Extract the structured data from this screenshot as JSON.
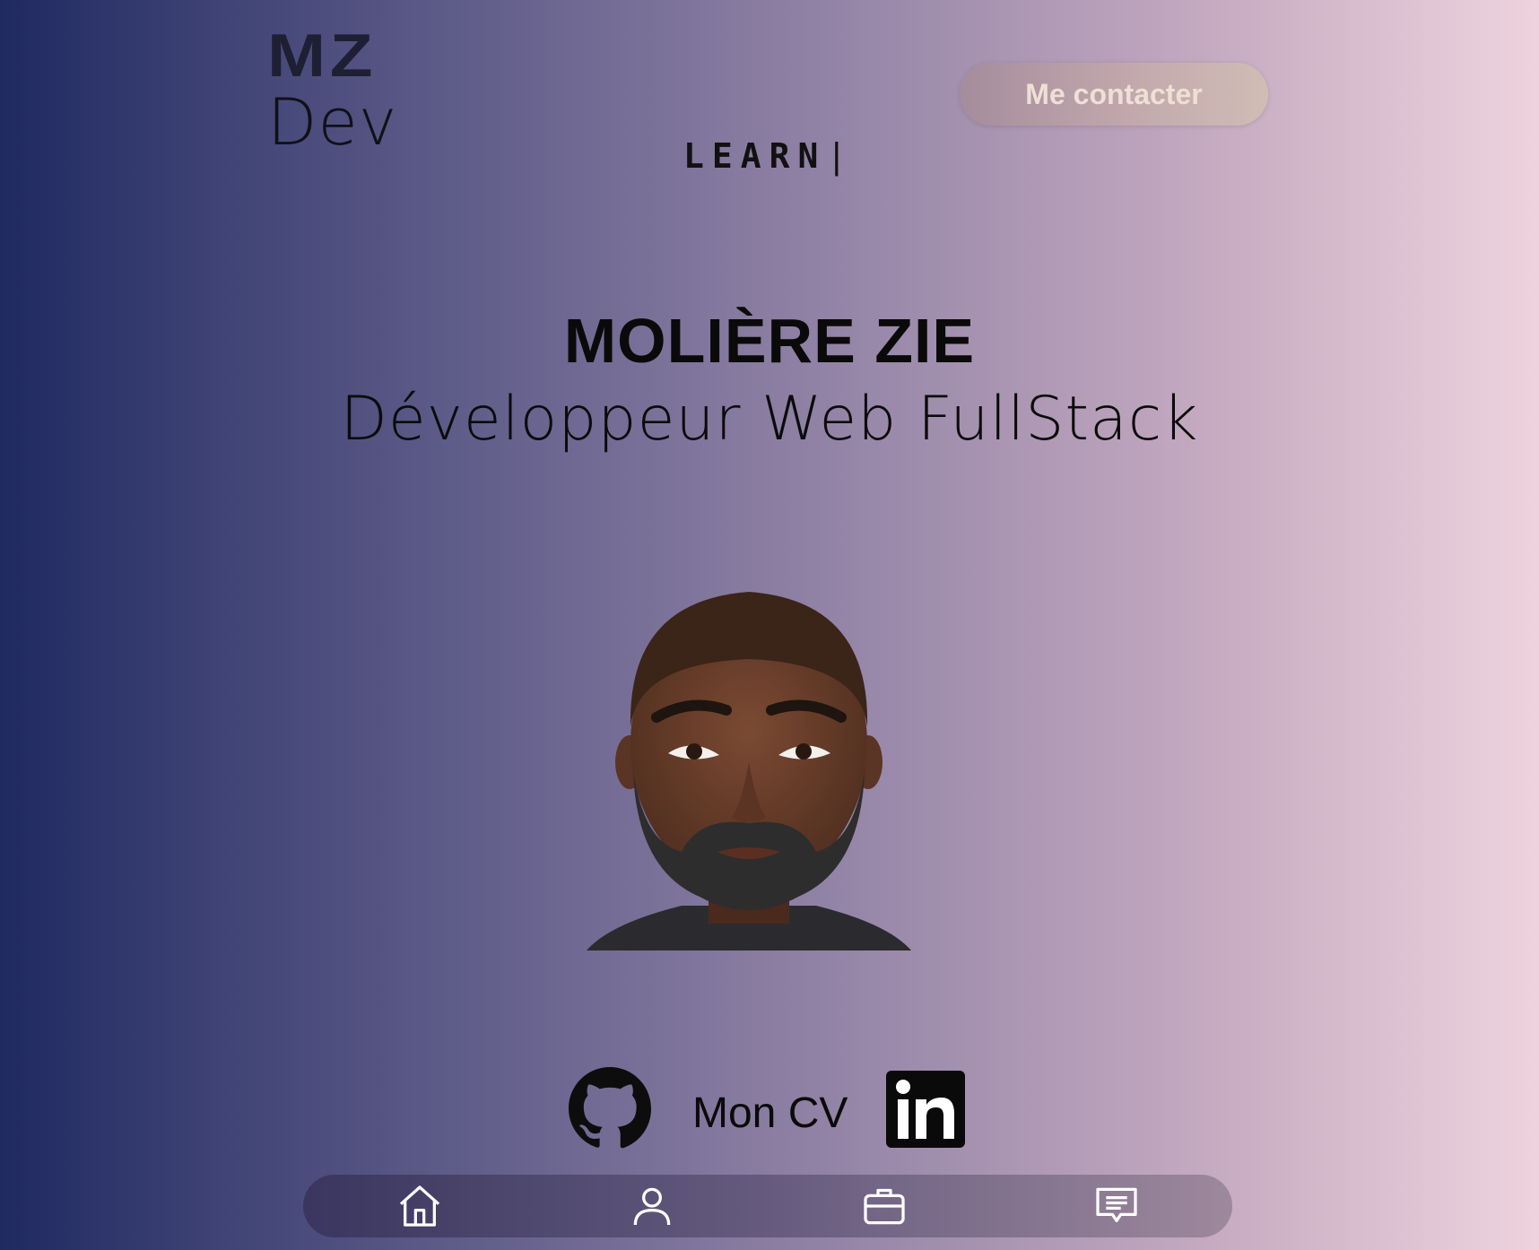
{
  "logo": {
    "line1": "MZ",
    "line2": "Dev"
  },
  "typing_text": {
    "word": "LEARN",
    "cursor": "|"
  },
  "header": {
    "contact_label": "Me contacter"
  },
  "hero": {
    "name": "MOLIÈRE ZIE",
    "role": "Développeur Web FullStack"
  },
  "socials": {
    "github_icon": "github-icon",
    "cv_label": "Mon CV",
    "linkedin_icon": "linkedin-icon",
    "linkedin_text": "in"
  },
  "nav": {
    "items": [
      {
        "icon": "home-icon"
      },
      {
        "icon": "user-icon"
      },
      {
        "icon": "briefcase-icon"
      },
      {
        "icon": "message-icon"
      }
    ]
  },
  "colors": {
    "gradient_start": "#1f2a61",
    "gradient_end": "#eed3de",
    "button_text": "#eee0d6"
  }
}
